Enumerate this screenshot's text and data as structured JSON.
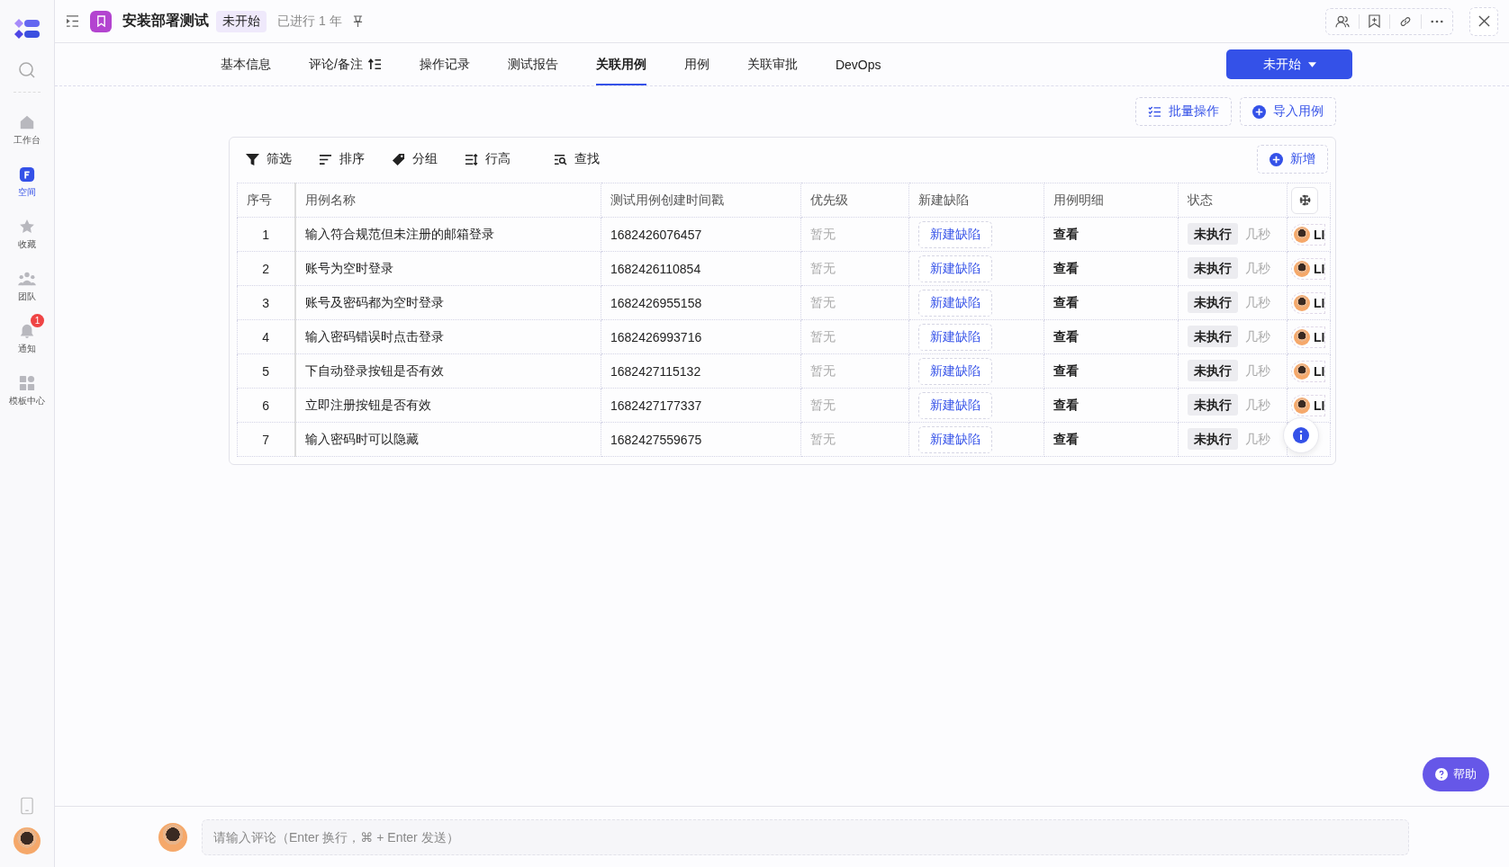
{
  "sidebar": {
    "items": [
      {
        "label": "工作台",
        "selected": false
      },
      {
        "label": "空间",
        "selected": true
      },
      {
        "label": "收藏",
        "selected": false
      },
      {
        "label": "团队",
        "selected": false
      },
      {
        "label": "通知",
        "selected": false,
        "badge": "1"
      },
      {
        "label": "模板中心",
        "selected": false
      }
    ]
  },
  "header": {
    "title": "安装部署测试",
    "status_badge": "未开始",
    "elapsed": "已进行 1 年"
  },
  "tabs": [
    {
      "label": "基本信息",
      "selected": false
    },
    {
      "label": "评论/备注",
      "selected": false
    },
    {
      "label": "操作记录",
      "selected": false
    },
    {
      "label": "测试报告",
      "selected": false
    },
    {
      "label": "关联用例",
      "selected": true
    },
    {
      "label": "用例",
      "selected": false
    },
    {
      "label": "关联审批",
      "selected": false
    },
    {
      "label": "DevOps",
      "selected": false
    }
  ],
  "status_button": "未开始",
  "actions": [
    {
      "label": "批量操作"
    },
    {
      "label": "导入用例"
    }
  ],
  "toolbar": [
    {
      "label": "筛选"
    },
    {
      "label": "排序"
    },
    {
      "label": "分组"
    },
    {
      "label": "行高"
    },
    {
      "label": "查找"
    }
  ],
  "add_button": "新增",
  "table": {
    "columns": [
      "序号",
      "用例名称",
      "测试用例创建时间戳",
      "优先级",
      "新建缺陷",
      "用例明细",
      "状态"
    ],
    "rows": [
      {
        "index": "1",
        "name": "输入符合规范但未注册的邮箱登录",
        "timestamp": "1682426076457",
        "priority": "暂无",
        "defect": "新建缺陷",
        "detail": "查看",
        "status": "未执行",
        "time": "几秒",
        "executor": "LI"
      },
      {
        "index": "2",
        "name": "账号为空时登录",
        "timestamp": "1682426110854",
        "priority": "暂无",
        "defect": "新建缺陷",
        "detail": "查看",
        "status": "未执行",
        "time": "几秒",
        "executor": "LI"
      },
      {
        "index": "3",
        "name": "账号及密码都为空时登录",
        "timestamp": "1682426955158",
        "priority": "暂无",
        "defect": "新建缺陷",
        "detail": "查看",
        "status": "未执行",
        "time": "几秒",
        "executor": "LI"
      },
      {
        "index": "4",
        "name": "输入密码错误时点击登录",
        "timestamp": "1682426993716",
        "priority": "暂无",
        "defect": "新建缺陷",
        "detail": "查看",
        "status": "未执行",
        "time": "几秒",
        "executor": "LI"
      },
      {
        "index": "5",
        "name": "下自动登录按钮是否有效",
        "timestamp": "1682427115132",
        "priority": "暂无",
        "defect": "新建缺陷",
        "detail": "查看",
        "status": "未执行",
        "time": "几秒",
        "executor": "LI"
      },
      {
        "index": "6",
        "name": "立即注册按钮是否有效",
        "timestamp": "1682427177337",
        "priority": "暂无",
        "defect": "新建缺陷",
        "detail": "查看",
        "status": "未执行",
        "time": "几秒",
        "executor": "LI"
      },
      {
        "index": "7",
        "name": "输入密码时可以隐藏",
        "timestamp": "1682427559675",
        "priority": "暂无",
        "defect": "新建缺陷",
        "detail": "查看",
        "status": "未执行",
        "time": "几秒"
      }
    ]
  },
  "comment": {
    "placeholder": "请输入评论（Enter 换行，⌘ + Enter 发送）"
  },
  "help_button": "帮助"
}
